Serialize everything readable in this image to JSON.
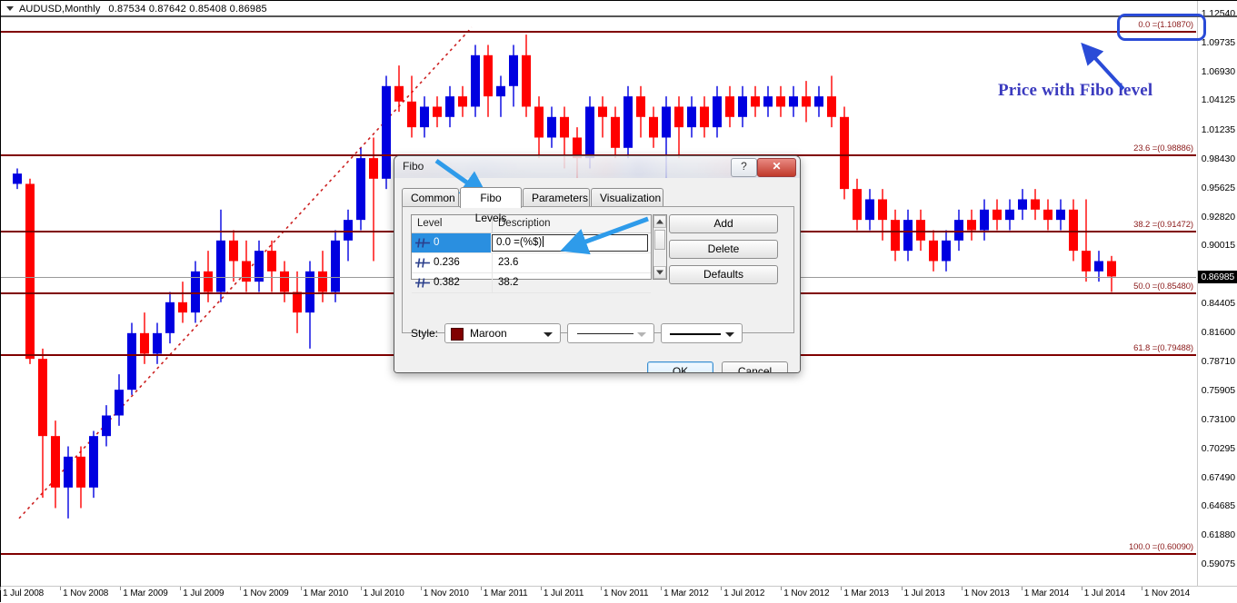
{
  "symbol_bar": {
    "symbol": "AUDUSD,Monthly",
    "ohlc": "0.87534 0.87642 0.85408 0.86985",
    "dropdown_icon": "caret-down-icon"
  },
  "chart": {
    "current_price": "0.86985",
    "price_ticks": [
      "1.12540",
      "1.09735",
      "1.06930",
      "1.04125",
      "1.01235",
      "0.98430",
      "0.95625",
      "0.92820",
      "0.90015",
      "0.84405",
      "0.81600",
      "0.78710",
      "0.75905",
      "0.73100",
      "0.70295",
      "0.67490",
      "0.64685",
      "0.61880",
      "0.59075"
    ],
    "date_ticks": [
      "1 Jul 2008",
      "1 Nov 2008",
      "1 Mar 2009",
      "1 Jul 2009",
      "1 Nov 2009",
      "1 Mar 2010",
      "1 Jul 2010",
      "1 Nov 2010",
      "1 Mar 2011",
      "1 Jul 2011",
      "1 Nov 2011",
      "1 Mar 2012",
      "1 Jul 2012",
      "1 Nov 2012",
      "1 Mar 2013",
      "1 Jul 2013",
      "1 Nov 2013",
      "1 Mar 2014",
      "1 Jul 2014",
      "1 Nov 2014"
    ],
    "fibo_labels": [
      "0.0 =(1.10870)",
      "23.6 =(0.98886)",
      "38.2 =(0.91472)",
      "50.0 =(0.85480)",
      "61.8 =(0.79488)",
      "100.0 =(0.60090)"
    ],
    "annotation": "Price with Fibo level",
    "colors": {
      "bull": "#0000E0",
      "bear": "#FF0000",
      "fibo_line": "#800000",
      "fibo_label": "#8B1A1A",
      "trendline": "#CC2222",
      "annotation": "#3B3BBF",
      "highlight": "#2A4BD7"
    }
  },
  "dialog": {
    "title": "Fibo",
    "help_label": "?",
    "close_label": "✕",
    "tabs": [
      {
        "label": "Common",
        "active": false
      },
      {
        "label": "Fibo Levels",
        "active": true
      },
      {
        "label": "Parameters",
        "active": false
      },
      {
        "label": "Visualization",
        "active": false
      }
    ],
    "table": {
      "columns": [
        "Level",
        "Description"
      ],
      "rows": [
        {
          "level": "0",
          "description": "0.0 =(%$)",
          "selected": true,
          "editing": true
        },
        {
          "level": "0.236",
          "description": "23.6",
          "selected": false,
          "editing": false
        },
        {
          "level": "0.382",
          "description": "38.2",
          "selected": false,
          "editing": false
        }
      ]
    },
    "side_buttons": [
      "Add",
      "Delete",
      "Defaults"
    ],
    "style": {
      "label": "Style:",
      "color_name": "Maroon",
      "color_hex": "#800000",
      "line_style_disabled": true
    },
    "footer_buttons": [
      {
        "label": "OK",
        "primary": true
      },
      {
        "label": "Cancel",
        "primary": false
      }
    ]
  }
}
